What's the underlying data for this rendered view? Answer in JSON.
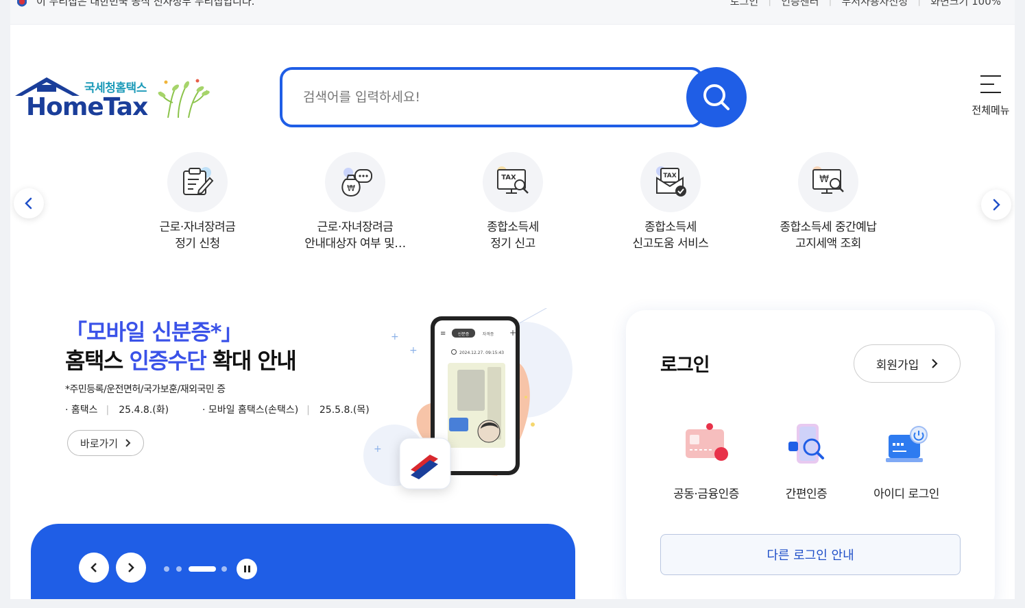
{
  "topbar": {
    "notice": "이 누리집은 대한민국 공식 전자정부 누리집입니다.",
    "links": [
      "로그인",
      "인증센터",
      "부서사용자신청",
      "화면크기 100%"
    ]
  },
  "logo": {
    "sub": "국세청홈택스",
    "main": "HomeTax"
  },
  "search": {
    "placeholder": "검색어를 입력하세요!"
  },
  "all_menu": {
    "label": "전체메뉴"
  },
  "quick_menu": [
    {
      "icon": "document-pen-icon",
      "label": "근로·자녀장려금\n정기 신청"
    },
    {
      "icon": "money-bag-chat-icon",
      "label": "근로·자녀장려금\n안내대상자 여부 및…"
    },
    {
      "icon": "tax-monitor-search-icon",
      "label": "종합소득세\n정기 신고"
    },
    {
      "icon": "tax-envelope-check-icon",
      "label": "종합소득세\n신고도움 서비스"
    },
    {
      "icon": "won-monitor-search-icon",
      "label": "종합소득세 중간예납\n고지세액 조회"
    }
  ],
  "banner": {
    "title_line1": "「모바일 신분증*」",
    "title_line2_pre": "홈택스 ",
    "title_line2_highlight": "인증수단",
    "title_line2_post": " 확대 안내",
    "note": "*주민등록/운전면허/국가보훈/재외국민 증",
    "date1_label": "· 홈택스",
    "date1_value": "25.4.8.(화)",
    "date2_label": "· 모바일 홈택스(손택스)",
    "date2_value": "25.5.8.(목)",
    "go_button": "바로가기",
    "phone_tab1": "신분증",
    "phone_tab2": "자격증",
    "phone_time": "2024.12.27. 09:15:43"
  },
  "login": {
    "title": "로그인",
    "join_button": "회원가입",
    "methods": [
      {
        "icon": "certificate-card-icon",
        "label": "공동·금융인증"
      },
      {
        "icon": "simple-auth-search-icon",
        "label": "간편인증"
      },
      {
        "icon": "id-login-icon",
        "label": "아이디 로그인"
      }
    ],
    "other_button": "다른 로그인 안내"
  },
  "colors": {
    "primary": "#1f5ee6",
    "banner_accent": "#3a52e8",
    "logo_navy": "#1a3e9a",
    "logo_teal": "#1c9ab8"
  }
}
